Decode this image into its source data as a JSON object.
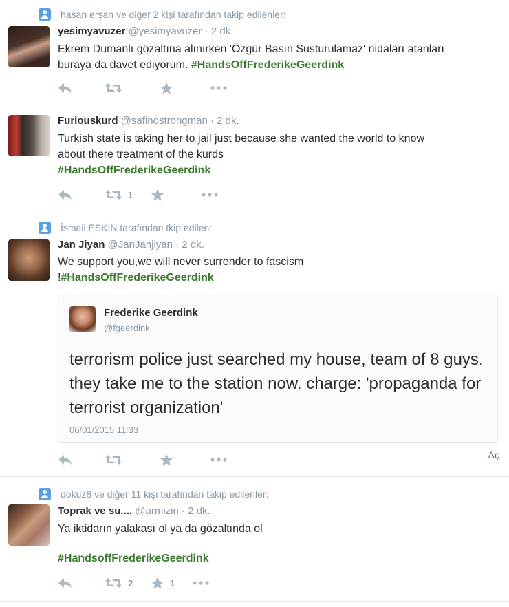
{
  "colors": {
    "hashtag": "#3b7a2f",
    "muted": "#8899a6",
    "icon": "#aab8c2",
    "context_icon": "#5aa1e3"
  },
  "tweets": [
    {
      "context": "hasan erşan ve diğer 2 kişi tarafından takip edilenler:",
      "fullname": "yesimyavuzer",
      "username": "@yesimyavuzer",
      "sep": " · ",
      "time": "2 dk.",
      "text_line1": "Ekrem Dumanlı gözaltına alınırken 'Özgür Basın Susturulamaz' nidaları atanları",
      "text_line2": "buraya da davet ediyorum. ",
      "hashtag": "#HandsOffFrederikeGeerdink",
      "retweets": "",
      "favorites": ""
    },
    {
      "context": "",
      "fullname": "Furiouskurd",
      "username": "@safinostrongman",
      "sep": " · ",
      "time": "2 dk.",
      "text_line1": "Turkish state is taking her to jail just because she wanted the world to know",
      "text_line2": "about there treatment of the kurds",
      "hashtag": "#HandsOffFrederikeGeerdink",
      "retweets": "1",
      "favorites": ""
    },
    {
      "context": "İsmail ESKİN tarafından tkip edilen:",
      "fullname": "Jan Jiyan",
      "username": "@JanJanjiyan",
      "sep": " · ",
      "time": "2 dk.",
      "text_line1": "We support you,we will never surrender to fascism",
      "text_prefix": "!",
      "hashtag": "#HandsOffFrederikeGeerdink",
      "retweets": "",
      "favorites": "",
      "quote": {
        "fullname": "Frederike Geerdink",
        "username": "@fgeerdink",
        "text": "terrorism police just searched my house, team of 8 guys. they take me to the station now. charge: 'propaganda for terrorist organization'",
        "date": "06/01/2015 11:33"
      },
      "open_label": "Aç"
    },
    {
      "context": "dokuz8 ve diğer 11 kişi tarafından takip edilenler:",
      "fullname": "Toprak ve su....",
      "username": "@armizin",
      "sep": " · ",
      "time": "2 dk.",
      "text_line1": "Ya iktidarın yalakası ol ya da gözaltında ol",
      "hashtag": "#HandsoffFrederikeGeerdink",
      "retweets": "2",
      "favorites": "1"
    }
  ]
}
